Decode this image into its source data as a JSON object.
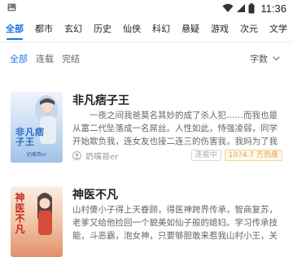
{
  "status_bar": {
    "time": "11:36",
    "left_icon": "image-notification-icon",
    "icons": [
      "wifi-icon",
      "signal-icon",
      "battery-icon"
    ]
  },
  "categories": [
    "全部",
    "都市",
    "玄幻",
    "历史",
    "仙侠",
    "科幻",
    "悬疑",
    "游戏",
    "次元",
    "文学"
  ],
  "active_category": "全部",
  "filters": {
    "items": [
      "全部",
      "连载",
      "完结"
    ],
    "active": "全部",
    "sort_label": "字数"
  },
  "books": [
    {
      "title": "非凡痞子王",
      "description": "一夜之间我爸莫名其妙的成了杀人犯……而我也是从富二代坠落成一名屌丝。人性如此，恃强凌弱，同学开始欺负我，连女友也接二连三的伤害我，我妈为了我居然在酒…",
      "author": "奶嘴哥er",
      "status": "连载中",
      "heat": "1074.7 万热度",
      "cover_title": "非凡痞子王",
      "cover_colors": {
        "top": "#d7e6f6",
        "bottom": "#9ec3e8",
        "text": "#2b6cc4"
      }
    },
    {
      "title": "神医不凡",
      "description": "山村傻小子得上天眷顾，得医神跨界传承，智商复苏，老爹又给他捡回一个貌美如仙子般的媳妇。学习传承技能，斗恶霸，泡女神，只要够胆敢来惹我山村小王，关注长兴",
      "author": "",
      "status": "",
      "heat": "",
      "cover_title": "神医不凡",
      "cover_colors": {
        "top": "#f6d9c4",
        "bottom": "#e48f6a",
        "text": "#c0291e"
      }
    }
  ],
  "colors": {
    "accent": "#1a73e8",
    "heat": "#e8a03a"
  }
}
